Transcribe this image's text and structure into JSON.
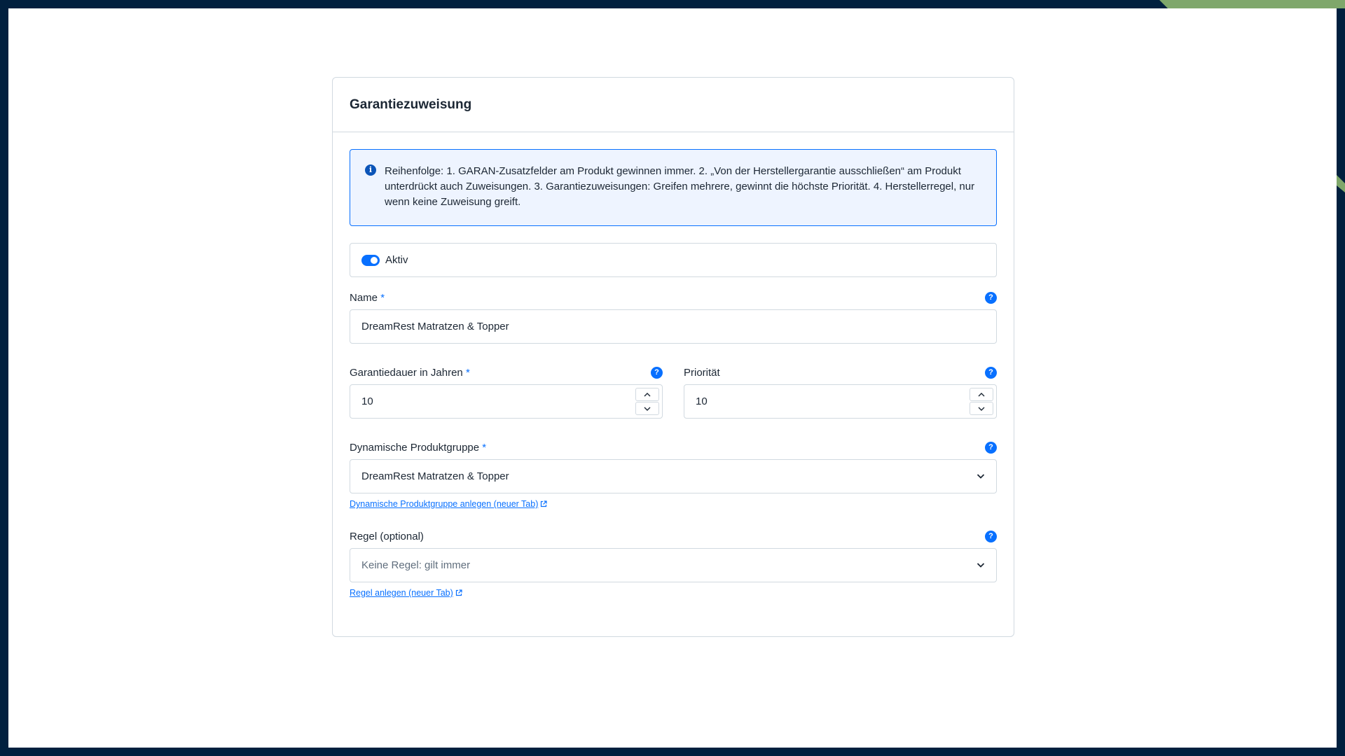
{
  "card": {
    "title": "Garantiezuweisung"
  },
  "info": {
    "text": "Reihenfolge: 1. GARAN-Zusatzfelder am Produkt gewinnen immer. 2. „Von der Herstellergarantie ausschließen“ am Produkt unterdrückt auch Zuweisungen. 3. Garantiezuweisungen: Greifen mehrere, gewinnt die höchste Priorität. 4. Herstellerregel, nur wenn keine Zuweisung greift."
  },
  "active": {
    "label": "Aktiv",
    "checked": true
  },
  "name": {
    "label": "Name",
    "required_mark": "*",
    "value": "DreamRest Matratzen & Topper"
  },
  "duration": {
    "label": "Garantiedauer in Jahren",
    "required_mark": "*",
    "value": "10"
  },
  "priority": {
    "label": "Priorität",
    "value": "10"
  },
  "product_group": {
    "label": "Dynamische Produktgruppe",
    "required_mark": "*",
    "selected": "DreamRest Matratzen & Topper",
    "link": "Dynamische Produktgruppe anlegen (neuer Tab)"
  },
  "rule": {
    "label": "Regel (optional)",
    "placeholder": "Keine Regel: gilt immer",
    "link": "Regel anlegen (neuer Tab)"
  },
  "colors": {
    "accent": "#0870ff",
    "frame": "#01203f",
    "corner": "#7fa76b"
  },
  "icons": {
    "help": "?",
    "info": "i"
  }
}
